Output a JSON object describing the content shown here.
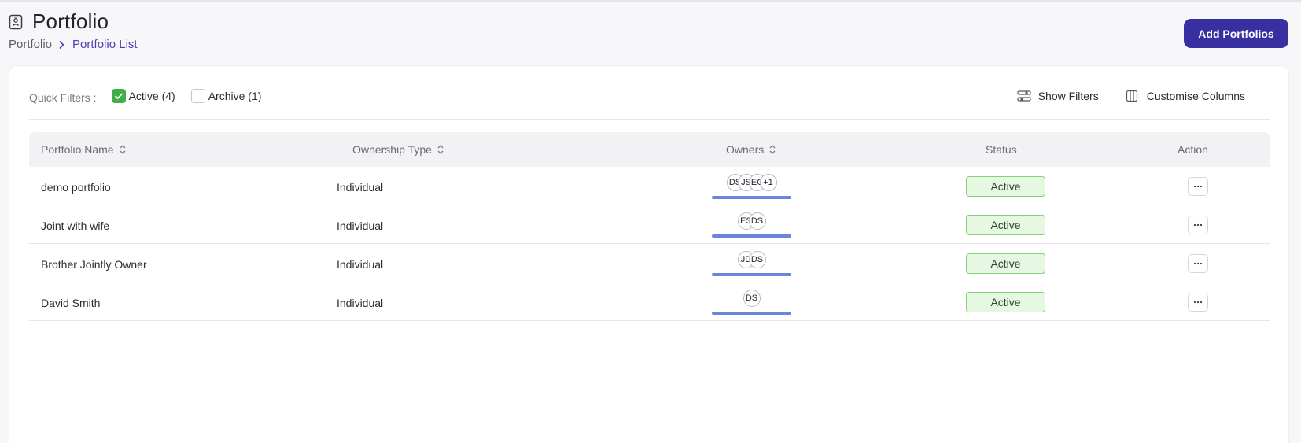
{
  "header": {
    "title": "Portfolio",
    "breadcrumb_root": "Portfolio",
    "breadcrumb_current": "Portfolio List",
    "add_button_label": "Add Portfolios"
  },
  "filters": {
    "quick_filters_label": "Quick Filters :",
    "active_label": "Active (4)",
    "active_checked": true,
    "archive_label": "Archive (1)",
    "archive_checked": false,
    "show_filters_label": "Show Filters",
    "customise_columns_label": "Customise Columns"
  },
  "table": {
    "columns": [
      "Portfolio Name",
      "Ownership Type",
      "Owners",
      "Status",
      "Action"
    ],
    "rows": [
      {
        "name": "demo portfolio",
        "ownership": "Individual",
        "owners": [
          "DS",
          "JS",
          "EC",
          "+1"
        ],
        "status": "Active"
      },
      {
        "name": "Joint with wife",
        "ownership": "Individual",
        "owners": [
          "ES",
          "DS"
        ],
        "status": "Active"
      },
      {
        "name": "Brother Jointly Owner",
        "ownership": "Individual",
        "owners": [
          "JD",
          "DS"
        ],
        "status": "Active"
      },
      {
        "name": "David Smith",
        "ownership": "Individual",
        "owners": [
          "DS"
        ],
        "status": "Active"
      }
    ]
  },
  "colors": {
    "primary": "#3a2fa0",
    "breadcrumb_link": "#4a3fb8",
    "checkbox_active": "#3fae49",
    "status_bg": "#e6f7e2",
    "status_border": "#86cf7d",
    "owner_bar": "#6b86d8"
  },
  "icons": {
    "page": "portfolio-id-icon",
    "breadcrumb_separator": "chevron-right-icon",
    "show_filters": "filter-sliders-icon",
    "customise_columns": "columns-icon",
    "sort": "sort-updown-icon",
    "action": "more-horizontal-icon"
  }
}
